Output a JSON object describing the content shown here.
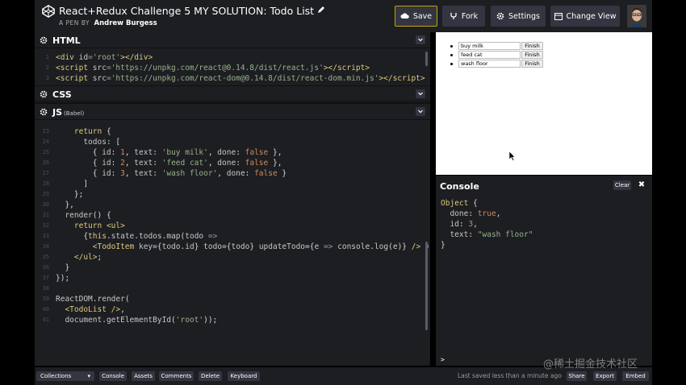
{
  "header": {
    "title": "React+Redux Challenge 5 MY SOLUTION: Todo List",
    "by_label": "A PEN BY",
    "author": "Andrew Burgess",
    "buttons": {
      "save": "Save",
      "fork": "Fork",
      "settings": "Settings",
      "change_view": "Change View"
    }
  },
  "editors": {
    "html": {
      "title": "HTML",
      "lines": [
        {
          "num": "1",
          "html": "<span class='tag'>&lt;div</span> <span class='a'>id</span><span class='p'>=</span><span class='s'>'root'</span><span class='tag'>&gt;&lt;/div&gt;</span>"
        },
        {
          "num": "2",
          "html": "<span class='tag'>&lt;script</span> <span class='a'>src</span><span class='p'>=</span><span class='s'>'https://unpkg.com/react@0.14.8/dist/react.js'</span><span class='tag'>&gt;&lt;/script&gt;</span>"
        },
        {
          "num": "3",
          "html": "<span class='tag'>&lt;script</span> <span class='a'>src</span><span class='p'>=</span><span class='s'>'https://unpkg.com/react-dom@0.14.8/dist/react-dom.min.js'</span><span class='tag'>&gt;&lt;/script&gt;</span>"
        }
      ]
    },
    "css": {
      "title": "CSS"
    },
    "js": {
      "title": "JS",
      "subtitle": "(Babel)",
      "lines": [
        {
          "num": "",
          "html": ""
        },
        {
          "num": "23",
          "html": "    <span class='k'>return</span> {"
        },
        {
          "num": "24",
          "html": "      <span class='a'>todos</span>: ["
        },
        {
          "num": "25",
          "html": "        { <span class='a'>id</span>: <span class='n'>1</span>, <span class='a'>text</span>: <span class='s'>'buy milk'</span>, <span class='a'>done</span>: <span class='n'>false</span> },"
        },
        {
          "num": "26",
          "html": "        { <span class='a'>id</span>: <span class='n'>2</span>, <span class='a'>text</span>: <span class='s'>'feed cat'</span>, <span class='a'>done</span>: <span class='n'>false</span> },"
        },
        {
          "num": "27",
          "html": "        { <span class='a'>id</span>: <span class='n'>3</span>, <span class='a'>text</span>: <span class='s'>'wash floor'</span>, <span class='a'>done</span>: <span class='n'>false</span> }"
        },
        {
          "num": "28",
          "html": "      ]"
        },
        {
          "num": "29",
          "html": "    };"
        },
        {
          "num": "30",
          "html": "  },"
        },
        {
          "num": "31",
          "html": "  <span class='a'>render</span>() {"
        },
        {
          "num": "32",
          "html": "    <span class='k'>return</span> <span class='tag'>&lt;ul&gt;</span>"
        },
        {
          "num": "33",
          "html": "      {<span class='k'>this</span>.<span class='a'>state</span>.<span class='a'>todos</span>.<span class='a'>map</span>(<span class='a'>todo</span> <span class='p'>=&gt;</span>"
        },
        {
          "num": "34",
          "html": "        <span class='tag'>&lt;TodoItem</span> <span class='a'>key</span>={<span class='a'>todo</span>.<span class='a'>id</span>} <span class='a'>todo</span>={<span class='a'>todo</span>} <span class='a'>updateTodo</span>={<span class='a'>e</span> <span class='p'>=&gt;</span> <span class='a'>console</span>.<span class='a'>log</span>(<span class='a'>e</span>)} <span class='tag'>/&gt;</span> )}"
        },
        {
          "num": "35",
          "html": "    <span class='tag'>&lt;/ul&gt;</span>;"
        },
        {
          "num": "36",
          "html": "  }"
        },
        {
          "num": "37",
          "html": "});"
        },
        {
          "num": "38",
          "html": ""
        },
        {
          "num": "39",
          "html": "<span class='a'>ReactDOM</span>.<span class='a'>render</span>("
        },
        {
          "num": "40",
          "html": "  <span class='tag'>&lt;TodoList /&gt;</span>,"
        },
        {
          "num": "41",
          "html": "  <span class='a'>document</span>.<span class='a'>getElementById</span>(<span class='s'>'root'</span>));"
        }
      ]
    }
  },
  "preview": {
    "todos": [
      {
        "text": "buy milk",
        "button": "Finish"
      },
      {
        "text": "feed cat",
        "button": "Finish"
      },
      {
        "text": "wash floor",
        "button": "Finish"
      }
    ]
  },
  "console": {
    "title": "Console",
    "clear": "Clear",
    "close": "✖",
    "lines": [
      {
        "html": "<span class='k'>Object</span> {"
      },
      {
        "html": "  <span class='a'>done</span>: <span class='n'>true</span>,"
      },
      {
        "html": "  <span class='a'>id</span>: <span class='n'>3</span>,"
      },
      {
        "html": "  <span class='a'>text</span>: <span class='s'>\"wash floor\"</span>"
      },
      {
        "html": "}"
      }
    ],
    "prompt": ">"
  },
  "footer": {
    "collections": "Collections",
    "buttons": [
      "Console",
      "Assets",
      "Comments",
      "Delete",
      "Keyboard"
    ],
    "saved_text": "Last saved less than a minute ago",
    "right_buttons": [
      "Share",
      "Export",
      "Embed"
    ]
  },
  "watermark": "@稀土掘金技术社区"
}
